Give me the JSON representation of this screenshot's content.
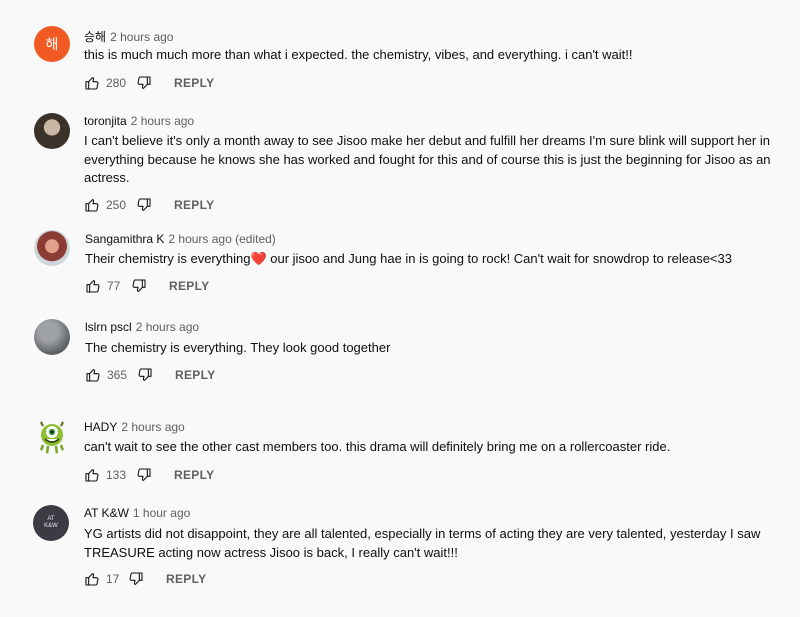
{
  "comments": [
    {
      "author": "승해",
      "time": "2 hours ago",
      "avatar_letter": "해",
      "text": "this is much much more than what i expected. the chemistry, vibes, and everything. i can't wait!!",
      "likes": "280",
      "reply": "REPLY"
    },
    {
      "author": "toronjita",
      "time": "2 hours ago",
      "text": "I can't believe it's only a month away to see Jisoo make her debut and fulfill her dreams I'm sure blink will support her in everything because he knows she has worked and fought for this and of course this is just the beginning for Jisoo as an actress.",
      "likes": "250",
      "reply": "REPLY"
    },
    {
      "author": "Sangamithra K",
      "time": "2 hours ago (edited)",
      "text_before": "Their chemistry is everything",
      "heart": "❤️",
      "text_after": " our jisoo and Jung hae in is going to rock! Can't wait for snowdrop to release<33",
      "likes": "77",
      "reply": "REPLY"
    },
    {
      "author": "lslrn pscl",
      "time": "2 hours ago",
      "text": "The chemistry is everything. They look good together",
      "likes": "365",
      "reply": "REPLY"
    },
    {
      "author": "HADY",
      "time": "2 hours ago",
      "text": "can't wait to see the other cast members too. this drama will definitely bring me on a rollercoaster ride.",
      "likes": "133",
      "reply": "REPLY"
    },
    {
      "author": "AT K&W",
      "time": "1 hour ago",
      "avatar_text_top": "AT",
      "avatar_text_bottom": "K&W",
      "text": "YG artists did not disappoint, they are all talented, especially in terms of acting they are very talented, yesterday I saw TREASURE acting now actress Jisoo is back, I really can't wait!!!",
      "likes": "17",
      "reply": "REPLY"
    }
  ]
}
